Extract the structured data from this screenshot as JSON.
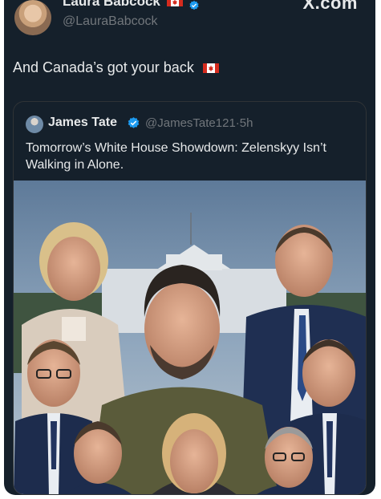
{
  "author": {
    "name": "Laura Babcock",
    "handle": "@LauraBabcock",
    "verified": true,
    "flag_icon": "canada-flag-icon"
  },
  "source_mark": "X.com",
  "post": {
    "text": "And Canada’s got your back",
    "flag_icon": "canada-flag-icon"
  },
  "quoted": {
    "name": "James Tate",
    "verified": true,
    "handle_time": "@JamesTate121·5h",
    "text": "Tomorrow’s White House Showdown: Zelenskyy Isn’t Walking in Alone.",
    "image_icon": "group-portrait-image"
  },
  "colors": {
    "background": "#15202b",
    "text": "#e7e9ea",
    "secondary": "#71767b",
    "verified": "#1d9bf0",
    "flag_red": "#d52b1e"
  }
}
